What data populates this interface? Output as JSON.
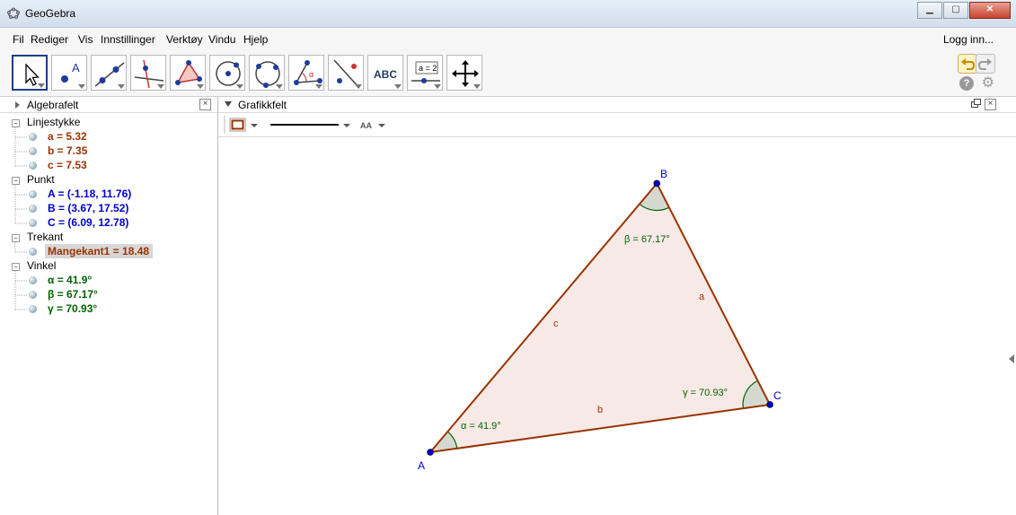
{
  "window": {
    "title": "GeoGebra",
    "controls": [
      "0",
      "1",
      "r"
    ]
  },
  "menu": {
    "items": [
      "Fil",
      "Rediger",
      "Vis",
      "Innstillinger",
      "Verktøy",
      "Vindu",
      "Hjelp"
    ],
    "login": "Logg inn..."
  },
  "toolbar": {
    "tools": [
      "move-tool",
      "point-tool",
      "line-tool",
      "perpendicular-line-tool",
      "polygon-tool",
      "circle-tool",
      "circle-three-points-tool",
      "angle-tool",
      "reflect-tool",
      "text-tool",
      "slider-tool",
      "move-graphics-view-tool"
    ],
    "point_label": "A",
    "angle_label": "α",
    "text_tool_label": "ABC",
    "slider_label": "a = 2"
  },
  "algebra": {
    "title": "Algebrafelt",
    "categories": [
      {
        "name": "Linjestykke",
        "items": [
          "a = 5.32",
          "b = 7.35",
          "c = 7.53"
        ]
      },
      {
        "name": "Punkt",
        "items": [
          "A = (-1.18, 11.76)",
          "B = (3.67, 17.52)",
          "C = (6.09, 12.78)"
        ]
      },
      {
        "name": "Trekant",
        "items": [
          "Mangekant1 = 18.48"
        ]
      },
      {
        "name": "Vinkel",
        "items": [
          "α = 41.9°",
          "β = 67.17°",
          "γ = 70.93°"
        ]
      }
    ]
  },
  "graphics": {
    "title": "Grafikkfelt",
    "text_style_label": "AA",
    "points": [
      {
        "name": "A",
        "x": -1.18,
        "y": 11.76
      },
      {
        "name": "B",
        "x": 3.67,
        "y": 17.52
      },
      {
        "name": "C",
        "x": 6.09,
        "y": 12.78
      }
    ],
    "segment_labels": {
      "a": "a",
      "b": "b",
      "c": "c"
    },
    "angle_labels": {
      "alpha": "α = 41.9°",
      "beta": "β = 67.17°",
      "gamma": "γ = 70.93°"
    },
    "colors": {
      "point": "#0000cc",
      "segment": "#993300",
      "fill": "#f6e9e6",
      "angle": "#006400",
      "angle_fill": "#d4d9d0"
    }
  }
}
